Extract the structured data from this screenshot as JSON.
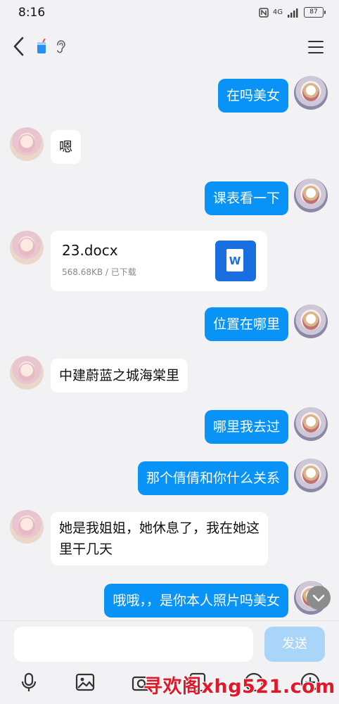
{
  "status_bar": {
    "time": "8:16",
    "network": "4G",
    "battery": "87"
  },
  "nav": {
    "back_icon": "chevron-left-icon",
    "cup_icon": "cup-icon",
    "ear_icon": "ear-icon",
    "menu_icon": "menu-icon"
  },
  "messages": [
    {
      "from": "me",
      "text": "在吗美女"
    },
    {
      "from": "her",
      "text": "嗯"
    },
    {
      "from": "me",
      "text": "课表看一下"
    },
    {
      "from": "her",
      "type": "file",
      "filename": "23.docx",
      "meta": "568.68KB / 已下载",
      "file_icon": "word-icon",
      "file_icon_letter": "W"
    },
    {
      "from": "me",
      "text": "位置在哪里"
    },
    {
      "from": "her",
      "text": "中建蔚蓝之城海棠里"
    },
    {
      "from": "me",
      "text": "哪里我去过"
    },
    {
      "from": "me",
      "text": "那个倩倩和你什么关系"
    },
    {
      "from": "her",
      "text": "她是我姐姐，她休息了，我在她这",
      "text_line2": "里干几天"
    },
    {
      "from": "me",
      "text": "哦哦，，是你本人照片吗美女"
    }
  ],
  "input": {
    "placeholder": "",
    "send_label": "发送"
  },
  "toolbar": [
    "microphone-icon",
    "image-icon",
    "camera-icon",
    "red-packet-icon",
    "emoji-icon",
    "plus-icon"
  ],
  "watermark": "寻欢阁xhg521.com",
  "colors": {
    "my_bubble": "#0a93f6",
    "her_bubble": "#ffffff",
    "background": "#f2f2f5",
    "send_disabled": "#a8d5f8"
  }
}
